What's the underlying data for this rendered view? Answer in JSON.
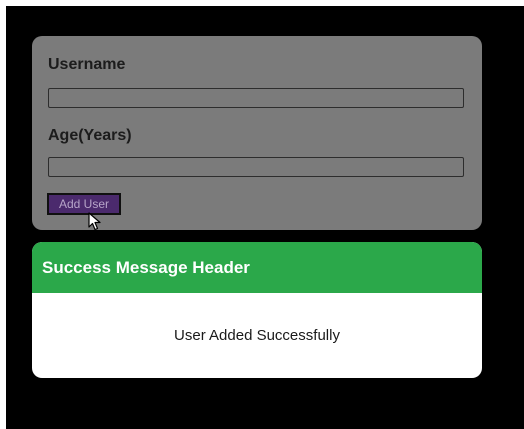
{
  "form": {
    "username_label": "Username",
    "username_value": "",
    "age_label": "Age(Years)",
    "age_value": "",
    "add_button_label": "Add User"
  },
  "success": {
    "header": "Success Message Header",
    "message": "User Added Successfully"
  },
  "colors": {
    "page_bg": "#000000",
    "form_bg": "#7b7b7b",
    "button_bg": "#4b2a6d",
    "success_header_bg": "#2ba84a",
    "success_body_bg": "#ffffff"
  },
  "icons": {
    "cursor": "mouse-pointer-icon"
  }
}
